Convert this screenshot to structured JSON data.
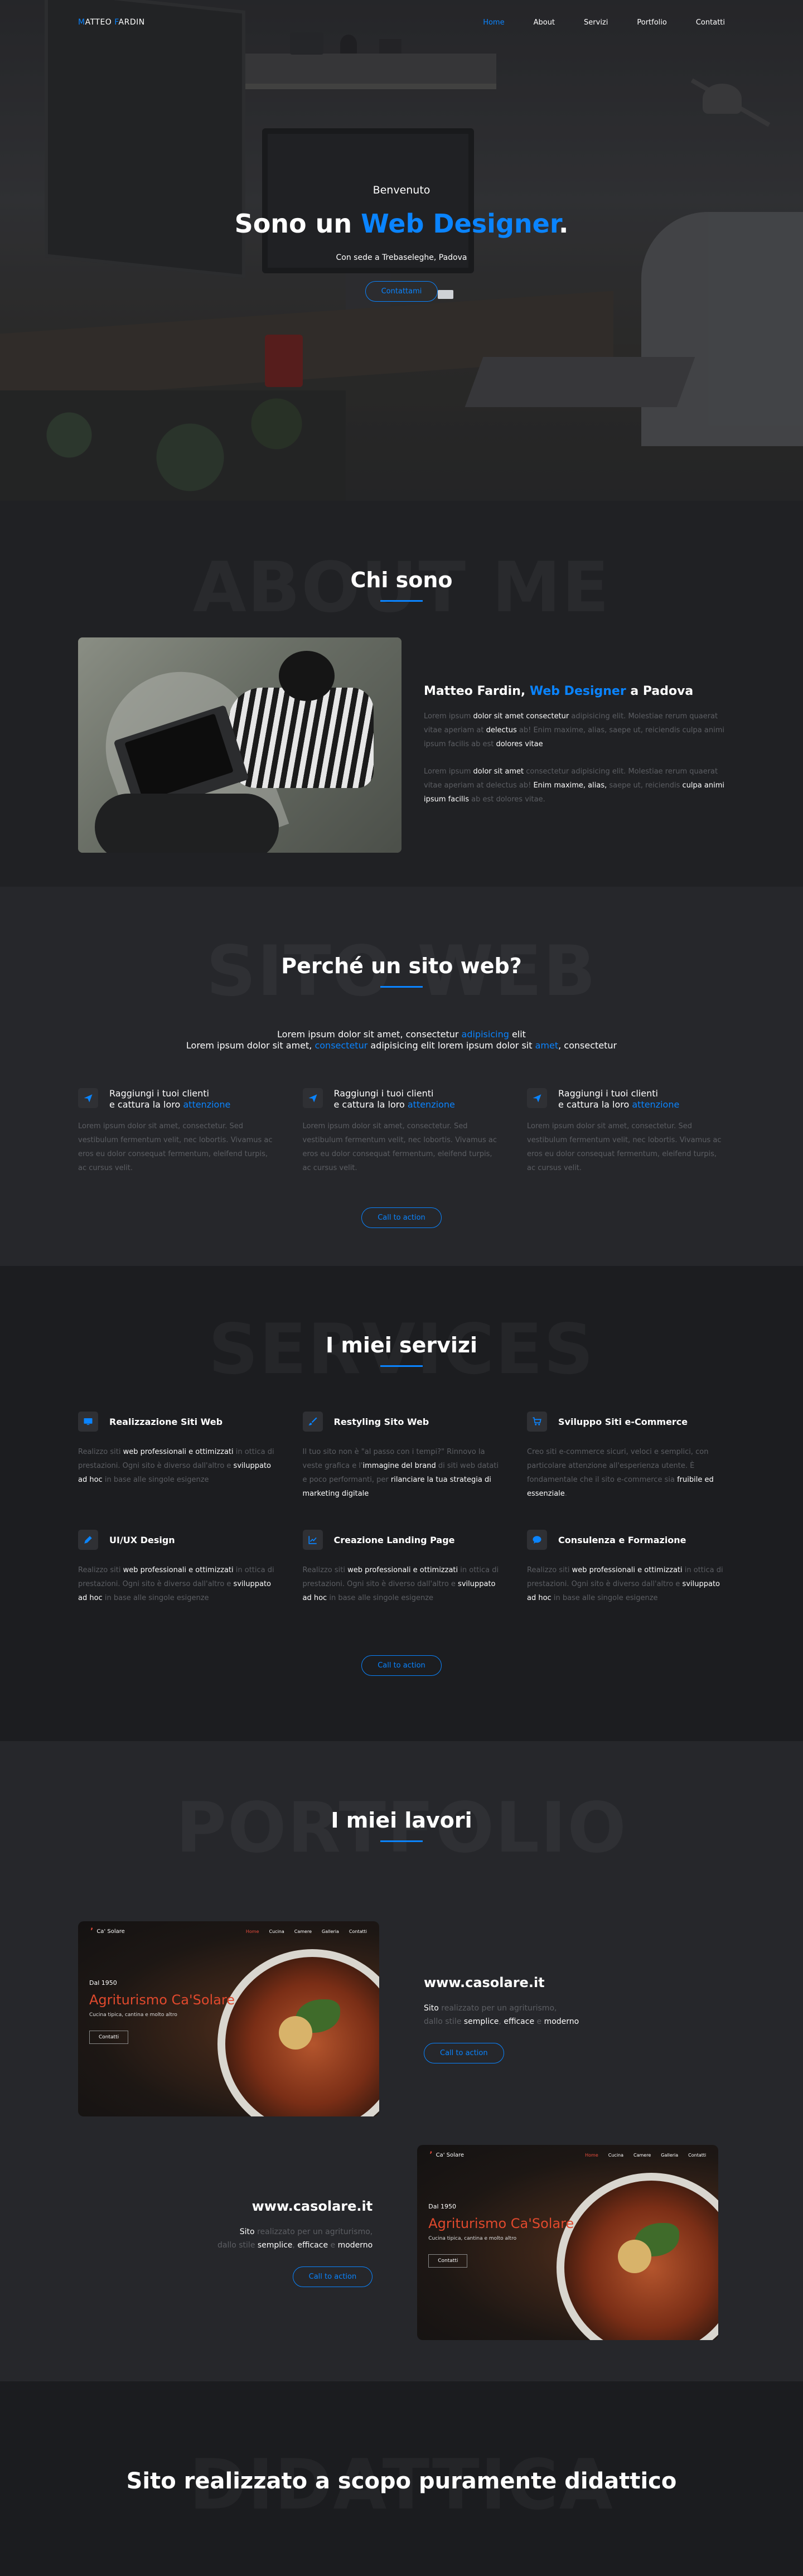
{
  "nav": {
    "logo_first": "M",
    "logo_rest": "ATTEO ",
    "logo_second": "F",
    "logo_rest2": "ARDIN",
    "items": [
      "Home",
      "About",
      "Servizi",
      "Portfolio",
      "Contatti"
    ]
  },
  "hero": {
    "kicker": "Benvenuto",
    "title_prefix": "Sono un ",
    "title_highlight": "Web Designer",
    "title_suffix": ".",
    "subtitle": "Con sede a Trebaseleghe, Padova",
    "button": "Contattami"
  },
  "about": {
    "ghost": "ABOUT ME",
    "title": "Chi sono",
    "heading_a": "Matteo Fardin, ",
    "heading_b": "Web Designer",
    "heading_c": " a Padova",
    "p1": {
      "a": "Lorem ipsum ",
      "b": "dolor sit amet consectetur",
      "c": " adipisicing elit. Molestiae rerum quaerat vitae aperiam at ",
      "d": "delectus",
      "e": " ab! Enim maxime, alias, saepe ut, reiciendis culpa animi ipsum facilis ab est ",
      "f": "dolores vitae"
    },
    "p2": {
      "a": "Lorem ipsum ",
      "b": "dolor sit amet",
      "c": " consectetur adipisicing elit. Molestiae rerum quaerat vitae aperiam at delectus ab! ",
      "d": "Enim maxime, alias,",
      "e": " saepe ut, reiciendis ",
      "f": "culpa animi ipsum facilis",
      "g": " ab est dolores vitae."
    }
  },
  "why": {
    "ghost": "SITO WEB",
    "title": "Perché un sito web?",
    "lead1_a": "Lorem ipsum dolor sit amet, consectetur ",
    "lead1_b": "adipisicing",
    "lead1_c": " elit",
    "lead2_a": "Lorem ipsum dolor sit amet, ",
    "lead2_b": "consectetur",
    "lead2_c": " adipisicing elit lorem ipsum dolor sit ",
    "lead2_d": "amet",
    "lead2_e": ", consectetur",
    "cols": [
      {
        "h1": "Raggiungi i tuoi clienti",
        "h2": "e cattura la loro ",
        "h3": "attenzione",
        "text": "Lorem ipsum dolor sit amet, consectetur. Sed vestibulum fermentum velit, nec lobortis. Vivamus ac eros eu dolor consequat fermentum, eleifend turpis, ac cursus velit."
      },
      {
        "h1": "Raggiungi i tuoi clienti",
        "h2": "e cattura la loro ",
        "h3": "attenzione",
        "text": "Lorem ipsum dolor sit amet, consectetur. Sed vestibulum fermentum velit, nec lobortis. Vivamus ac eros eu dolor consequat fermentum, eleifend turpis, ac cursus velit."
      },
      {
        "h1": "Raggiungi i tuoi clienti",
        "h2": "e cattura la loro ",
        "h3": "attenzione",
        "text": "Lorem ipsum dolor sit amet, consectetur. Sed vestibulum fermentum velit, nec lobortis. Vivamus ac eros eu dolor consequat fermentum, eleifend turpis, ac cursus velit."
      }
    ],
    "button": "Call to action"
  },
  "services": {
    "ghost": "SERVICES",
    "title": "I miei servizi",
    "items": [
      {
        "icon": "monitor-icon",
        "title": "Realizzazione Siti Web",
        "a": "Realizzo siti ",
        "b": "web professionali e ottimizzati",
        "c": " in ottica di prestazioni. Ogni sito è diverso dall'altro e ",
        "d": "sviluppato ad hoc",
        "e": " in base alle singole esigenze"
      },
      {
        "icon": "brush-icon",
        "title": "Restyling Sito Web",
        "a": "Il tuo sito non è \"al passo con i tempi?\" Rinnovo la veste grafica e l'",
        "b": "immagine del brand",
        "c": " di siti web datati e poco performanti, per ",
        "d": "rilanciare la tua strategia di marketing digitale",
        "e": ""
      },
      {
        "icon": "cart-icon",
        "title": "Sviluppo Siti e-Commerce",
        "a": "Creo siti e-commerce sicuri, veloci e semplici, con particolare attenzione all'esperienza utente. È fondamentale che il sito e-commerce sia ",
        "b": "fruibile ed essenziale",
        "c": ".",
        "d": "",
        "e": ""
      },
      {
        "icon": "pen-icon",
        "title": "UI/UX Design",
        "a": "Realizzo siti ",
        "b": "web professionali e ottimizzati",
        "c": " in ottica di prestazioni. Ogni sito è diverso dall'altro e ",
        "d": "sviluppato ad hoc",
        "e": " in base alle singole esigenze"
      },
      {
        "icon": "chart-icon",
        "title": "Creazione Landing Page",
        "a": "Realizzo siti ",
        "b": "web professionali e ottimizzati",
        "c": " in ottica di prestazioni. Ogni sito è diverso dall'altro e ",
        "d": "sviluppato ad hoc",
        "e": " in base alle singole esigenze"
      },
      {
        "icon": "chat-icon",
        "title": "Consulenza e Formazione",
        "a": "Realizzo siti ",
        "b": "web professionali e ottimizzati",
        "c": " in ottica di prestazioni. Ogni sito è diverso dall'altro e ",
        "d": "sviluppato ad hoc",
        "e": " in base alle singole esigenze"
      }
    ],
    "button": "Call to action"
  },
  "portfolio": {
    "ghost": "PORTFOLIO",
    "title": "I miei lavori",
    "projects": [
      {
        "url": "www.casolare.it",
        "d1a": "Sito",
        "d1b": " realizzato per un agriturismo,",
        "d2a": "dallo stile ",
        "d2b": "semplice",
        "d2c": ", ",
        "d2d": "efficace",
        "d2e": " e ",
        "d2f": "moderno",
        "button": "Call to action"
      },
      {
        "url": "www.casolare.it",
        "d1a": "Sito",
        "d1b": " realizzato per un agriturismo,",
        "d2a": "dallo stile ",
        "d2b": "semplice",
        "d2c": ", ",
        "d2d": "efficace",
        "d2e": " e ",
        "d2f": "moderno",
        "button": "Call to action"
      }
    ],
    "mock": {
      "logo": "Ca' Solare",
      "links": [
        "Home",
        "Cucina",
        "Camere",
        "Galleria",
        "Contatti"
      ],
      "since": "Dal 1950",
      "name": "Agriturismo Ca'Solare",
      "tagline": "Cucina tipica, cantina e molto altro",
      "button": "Contatti"
    }
  },
  "didattica": {
    "ghost": "DIDATTICA",
    "title": "Sito realizzato a scopo puramente didattico"
  },
  "colors": {
    "accent": "#0a84ff",
    "bg": "#1b1c1f",
    "muted": "#5c5e63"
  }
}
